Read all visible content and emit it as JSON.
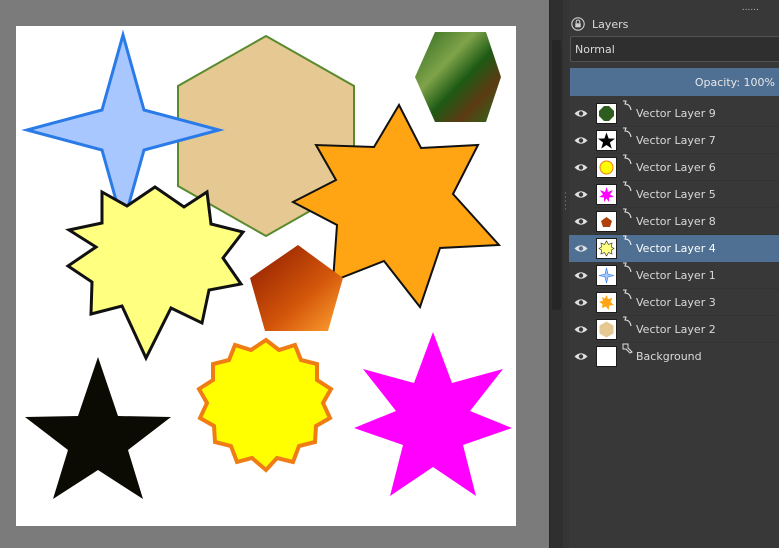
{
  "panel": {
    "title": "Layers",
    "grip": "......",
    "blend_mode": "Normal",
    "opacity_label": "Opacity:  100%"
  },
  "layers": [
    {
      "name": "Vector Layer 9",
      "thumb": "green-octagon",
      "selected": false
    },
    {
      "name": "Vector Layer 7",
      "thumb": "black-star",
      "selected": false
    },
    {
      "name": "Vector Layer 6",
      "thumb": "yellow-burst",
      "selected": false
    },
    {
      "name": "Vector Layer 5",
      "thumb": "magenta-star",
      "selected": false
    },
    {
      "name": "Vector Layer 8",
      "thumb": "orange-pentagon",
      "selected": false
    },
    {
      "name": "Vector Layer 4",
      "thumb": "light-yellow-star",
      "selected": true
    },
    {
      "name": "Vector Layer 1",
      "thumb": "blue-four-point-star",
      "selected": false
    },
    {
      "name": "Vector Layer 3",
      "thumb": "orange-seven-point-star",
      "selected": false
    },
    {
      "name": "Vector Layer 2",
      "thumb": "tan-hexagon",
      "selected": false
    },
    {
      "name": "Background",
      "thumb": "white",
      "selected": false
    }
  ],
  "colors": {
    "accent": "#4f6f93",
    "blue_star": "#a8c7ff",
    "blue_star_stroke": "#2a7be8",
    "hexagon": "#e6c992",
    "hexagon_stroke": "#5a8a2e",
    "orange_star": "#ffa412",
    "light_yellow_star": "#ffff80",
    "yellow_burst": "#ffff00",
    "yellow_burst_stroke": "#f07d14",
    "magenta_star": "#ff00ff",
    "black_star": "#0b0b04"
  }
}
